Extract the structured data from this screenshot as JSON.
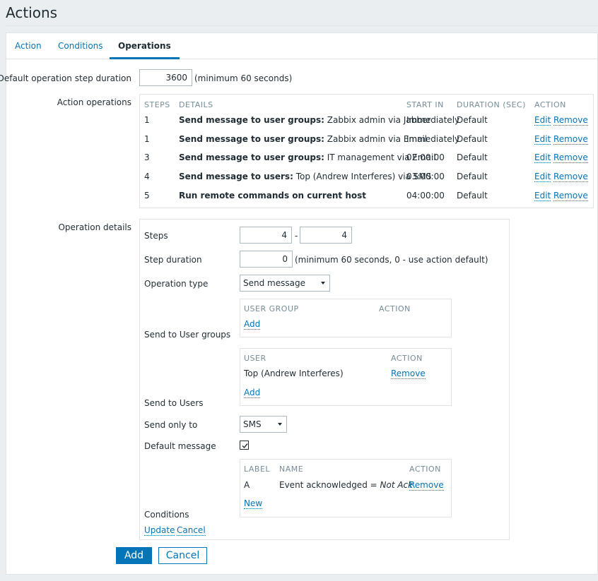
{
  "page": {
    "title": "Actions"
  },
  "tabs": [
    {
      "label": "Action",
      "active": false
    },
    {
      "label": "Conditions",
      "active": false
    },
    {
      "label": "Operations",
      "active": true
    }
  ],
  "form": {
    "default_step_duration": {
      "label": "Default operation step duration",
      "value": "3600",
      "hint": "(minimum 60 seconds)"
    },
    "action_operations": {
      "label": "Action operations",
      "columns": [
        "STEPS",
        "DETAILS",
        "START IN",
        "DURATION (SEC)",
        "ACTION"
      ],
      "rows": [
        {
          "steps": "1",
          "details_bold": "Send message to user groups:",
          "details_rest": " Zabbix admin via Jabber",
          "start_in": "Immediately",
          "duration": "Default",
          "edit": "Edit",
          "remove": "Remove"
        },
        {
          "steps": "1",
          "details_bold": "Send message to user groups:",
          "details_rest": " Zabbix admin via Email",
          "start_in": "Immediately",
          "duration": "Default",
          "edit": "Edit",
          "remove": "Remove"
        },
        {
          "steps": "3",
          "details_bold": "Send message to user groups:",
          "details_rest": " IT management via Email",
          "start_in": "02:00:00",
          "duration": "Default",
          "edit": "Edit",
          "remove": "Remove"
        },
        {
          "steps": "4",
          "details_bold": "Send message to users:",
          "details_rest": " Top (Andrew Interferes) via SMS",
          "start_in": "03:00:00",
          "duration": "Default",
          "edit": "Edit",
          "remove": "Remove"
        },
        {
          "steps": "5",
          "details_bold": "Run remote commands on current host",
          "details_rest": "",
          "start_in": "04:00:00",
          "duration": "Default",
          "edit": "Edit",
          "remove": "Remove"
        }
      ]
    },
    "operation_details": {
      "label": "Operation details",
      "steps": {
        "label": "Steps",
        "from": "4",
        "separator": "-",
        "to": "4"
      },
      "step_duration": {
        "label": "Step duration",
        "value": "0",
        "hint": "(minimum 60 seconds, 0 - use action default)"
      },
      "operation_type": {
        "label": "Operation type",
        "value": "Send message"
      },
      "send_to_user_groups": {
        "label": "Send to User groups",
        "columns": [
          "USER GROUP",
          "ACTION"
        ],
        "add": "Add"
      },
      "send_to_users": {
        "label": "Send to Users",
        "columns": [
          "USER",
          "ACTION"
        ],
        "rows": [
          {
            "user": "Top (Andrew Interferes)",
            "remove": "Remove"
          }
        ],
        "add": "Add"
      },
      "send_only_to": {
        "label": "Send only to",
        "value": "SMS"
      },
      "default_message": {
        "label": "Default message",
        "checked": true
      },
      "conditions": {
        "label": "Conditions",
        "columns": [
          "LABEL",
          "NAME",
          "ACTION"
        ],
        "rows": [
          {
            "label": "A",
            "name_plain": "Event acknowledged = ",
            "name_italic": "Not Ack",
            "remove": "Remove"
          }
        ],
        "new": "New"
      },
      "update": "Update",
      "cancel": "Cancel"
    },
    "buttons": {
      "add": "Add",
      "cancel": "Cancel"
    }
  },
  "icons": {
    "select_arrow": "chevron-down-icon",
    "checkbox": "check-icon"
  },
  "colors": {
    "link": "#0275b8",
    "primary": "#0275b8",
    "header_text": "#768d99",
    "border": "#dfe4e7"
  }
}
